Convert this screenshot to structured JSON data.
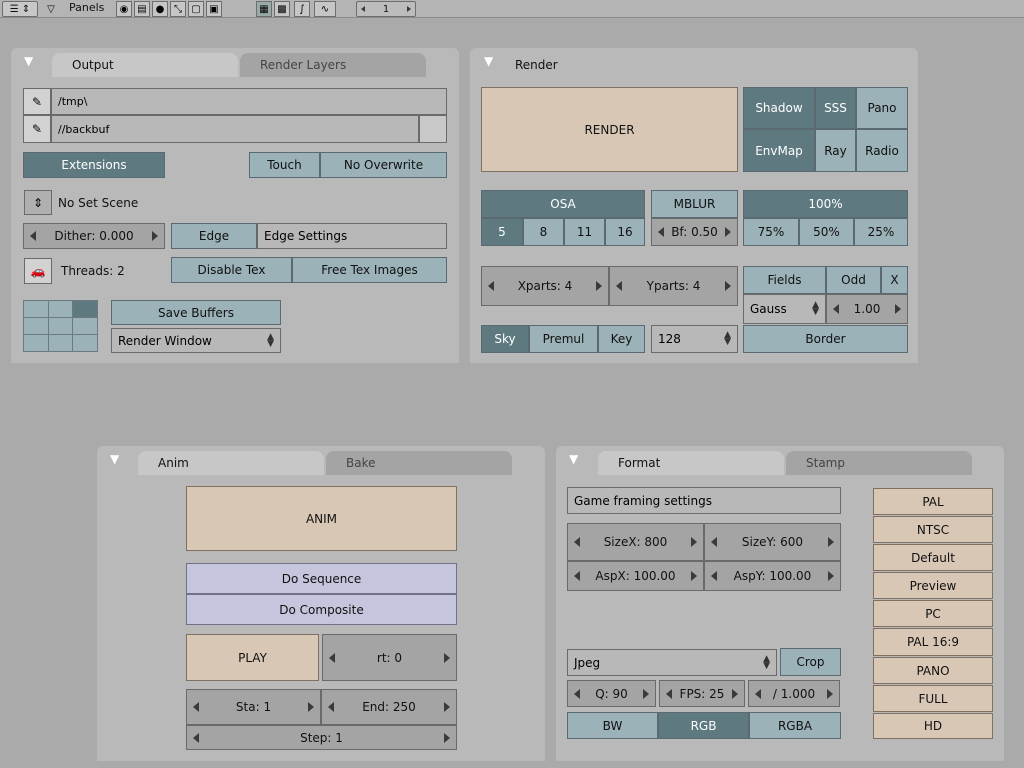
{
  "header": {
    "panels_label": "Panels",
    "frame_value": "1"
  },
  "output": {
    "tab_output": "Output",
    "tab_render_layers": "Render Layers",
    "path_render": "/tmp\\",
    "path_backbuf": "//backbuf",
    "extensions": "Extensions",
    "touch": "Touch",
    "no_overwrite": "No Overwrite",
    "scene_label": "No Set Scene",
    "dither": "Dither: 0.000",
    "edge": "Edge",
    "edge_settings": "Edge Settings",
    "threads": "Threads: 2",
    "disable_tex": "Disable Tex",
    "free_tex_images": "Free Tex Images",
    "save_buffers": "Save Buffers",
    "render_window": "Render Window"
  },
  "render": {
    "title": "Render",
    "render_btn": "RENDER",
    "shadow": "Shadow",
    "sss": "SSS",
    "pano": "Pano",
    "envmap": "EnvMap",
    "ray": "Ray",
    "radio": "Radio",
    "osa": "OSA",
    "osa_values": [
      "5",
      "8",
      "11",
      "16"
    ],
    "mblur": "MBLUR",
    "bf": "Bf: 0.50",
    "percent_main": "100%",
    "percents": [
      "75%",
      "50%",
      "25%"
    ],
    "xparts": "Xparts: 4",
    "yparts": "Yparts: 4",
    "fields": "Fields",
    "odd": "Odd",
    "x": "X",
    "gauss": "Gauss",
    "gauss_value": "1.00",
    "sky": "Sky",
    "premul": "Premul",
    "key": "Key",
    "samples": "128",
    "border": "Border"
  },
  "anim": {
    "tab_anim": "Anim",
    "tab_bake": "Bake",
    "anim_btn": "ANIM",
    "do_sequence": "Do Sequence",
    "do_composite": "Do Composite",
    "play": "PLAY",
    "rt": "rt: 0",
    "sta": "Sta: 1",
    "end": "End: 250",
    "step": "Step: 1"
  },
  "format": {
    "tab_format": "Format",
    "tab_stamp": "Stamp",
    "game_framing": "Game framing settings",
    "sizex": "SizeX: 800",
    "sizey": "SizeY: 600",
    "aspx": "AspX: 100.00",
    "aspy": "AspY: 100.00",
    "codec": "Jpeg",
    "crop": "Crop",
    "quality": "Q: 90",
    "fps": "FPS: 25",
    "fps_base": "/ 1.000",
    "bw": "BW",
    "rgb": "RGB",
    "rgba": "RGBA",
    "presets": [
      "PAL",
      "NTSC",
      "Default",
      "Preview",
      "PC",
      "PAL 16:9",
      "PANO",
      "FULL",
      "HD"
    ]
  }
}
